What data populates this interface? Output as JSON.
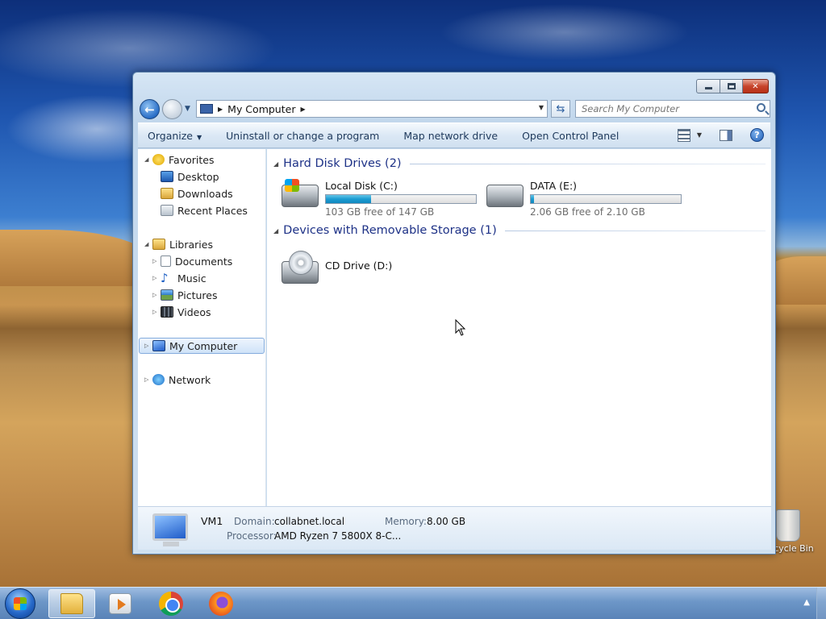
{
  "window": {
    "address": {
      "crumb": "My Computer"
    },
    "search": {
      "placeholder": "Search My Computer"
    }
  },
  "toolbar": {
    "organize": "Organize",
    "uninstall": "Uninstall or change a program",
    "map_drive": "Map network drive",
    "control_panel": "Open Control Panel",
    "help": "?"
  },
  "nav": {
    "favorites": "Favorites",
    "desktop": "Desktop",
    "downloads": "Downloads",
    "recent": "Recent Places",
    "libraries": "Libraries",
    "documents": "Documents",
    "music": "Music",
    "pictures": "Pictures",
    "videos": "Videos",
    "computer": "My Computer",
    "network": "Network"
  },
  "content": {
    "hdd_group": "Hard Disk Drives (2)",
    "removable_group": "Devices with Removable Storage (1)",
    "drives": [
      {
        "name": "Local Disk (C:)",
        "free": "103 GB free of 147 GB",
        "used_fraction": 0.3
      },
      {
        "name": "DATA (E:)",
        "free": "2.06 GB free of 2.10 GB",
        "used_fraction": 0.02
      }
    ],
    "cd": {
      "name": "CD Drive (D:)"
    }
  },
  "details": {
    "name": "VM1",
    "domain_label": "Domain:",
    "domain_value": "collabnet.local",
    "memory_label": "Memory:",
    "memory_value": "8.00 GB",
    "processor_label": "Processor:",
    "processor_value": "AMD Ryzen 7 5800X 8-C..."
  },
  "desktop": {
    "recycle_bin": "Recycle Bin"
  },
  "colors": {
    "accent": "#1e3287",
    "drive_bar": "#1a9bd1"
  }
}
